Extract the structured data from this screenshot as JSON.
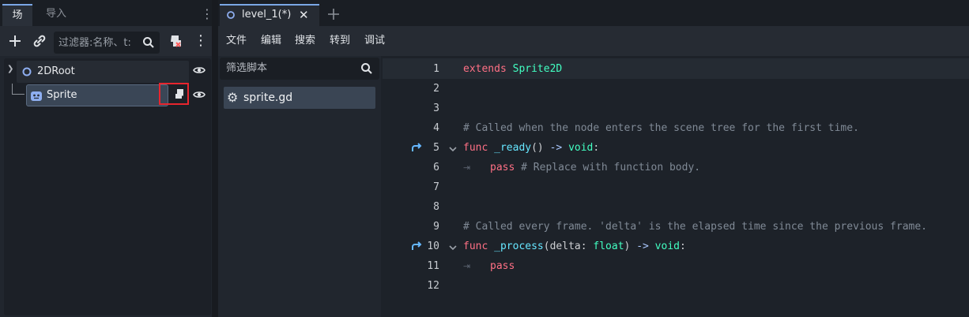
{
  "left_dock": {
    "tabs": [
      {
        "label": "场景",
        "active": true
      },
      {
        "label": "导入",
        "active": false
      }
    ],
    "filter": {
      "placeholder": "过滤器:名称、t:"
    },
    "tree": [
      {
        "label": "2DRoot",
        "icon": "node2d-circle-icon"
      },
      {
        "label": "Sprite",
        "icon": "sprite-icon",
        "selected": true
      }
    ]
  },
  "editor": {
    "tab": {
      "label": "level_1(*)"
    },
    "menus": [
      "文件",
      "编辑",
      "搜索",
      "转到",
      "调试"
    ],
    "script_filter": {
      "placeholder": "筛选脚本"
    },
    "scripts": [
      {
        "label": "sprite.gd",
        "icon": "gear-icon"
      }
    ],
    "code_lines": [
      {
        "n": "1",
        "tokens": [
          {
            "t": "extends",
            "c": "kw"
          },
          {
            "t": " ",
            "c": "plain"
          },
          {
            "t": "Sprite2D",
            "c": "type"
          }
        ]
      },
      {
        "n": "2",
        "tokens": []
      },
      {
        "n": "3",
        "tokens": []
      },
      {
        "n": "4",
        "tokens": [
          {
            "t": "# Called when the node enters the scene tree for the first time.",
            "c": "cm"
          }
        ]
      },
      {
        "n": "5",
        "fold": true,
        "override": true,
        "tokens": [
          {
            "t": "func",
            "c": "kw"
          },
          {
            "t": " ",
            "c": "plain"
          },
          {
            "t": "_ready",
            "c": "fn"
          },
          {
            "t": "() ",
            "c": "plain"
          },
          {
            "t": "->",
            "c": "op"
          },
          {
            "t": " ",
            "c": "plain"
          },
          {
            "t": "void",
            "c": "type"
          },
          {
            "t": ":",
            "c": "plain"
          }
        ]
      },
      {
        "n": "6",
        "indent": true,
        "tokens": [
          {
            "t": "pass",
            "c": "kw"
          },
          {
            "t": " # Replace with function body.",
            "c": "cm"
          }
        ]
      },
      {
        "n": "7",
        "tokens": []
      },
      {
        "n": "8",
        "tokens": []
      },
      {
        "n": "9",
        "tokens": [
          {
            "t": "# Called every frame. 'delta' is the elapsed time since the previous frame.",
            "c": "cm"
          }
        ]
      },
      {
        "n": "10",
        "fold": true,
        "override": true,
        "tokens": [
          {
            "t": "func",
            "c": "kw"
          },
          {
            "t": " ",
            "c": "plain"
          },
          {
            "t": "_process",
            "c": "fn"
          },
          {
            "t": "(delta: ",
            "c": "plain"
          },
          {
            "t": "float",
            "c": "type"
          },
          {
            "t": ") ",
            "c": "plain"
          },
          {
            "t": "->",
            "c": "op"
          },
          {
            "t": " ",
            "c": "plain"
          },
          {
            "t": "void",
            "c": "type"
          },
          {
            "t": ":",
            "c": "plain"
          }
        ]
      },
      {
        "n": "11",
        "indent": true,
        "tokens": [
          {
            "t": "pass",
            "c": "kw"
          }
        ]
      },
      {
        "n": "12",
        "tokens": []
      }
    ]
  },
  "colors": {
    "accent": "#7ba7e6",
    "highlight_box": "#e8252e",
    "keyword": "#ff7085",
    "type": "#42ffc2",
    "function": "#66e6ff",
    "comment": "#808a96"
  }
}
